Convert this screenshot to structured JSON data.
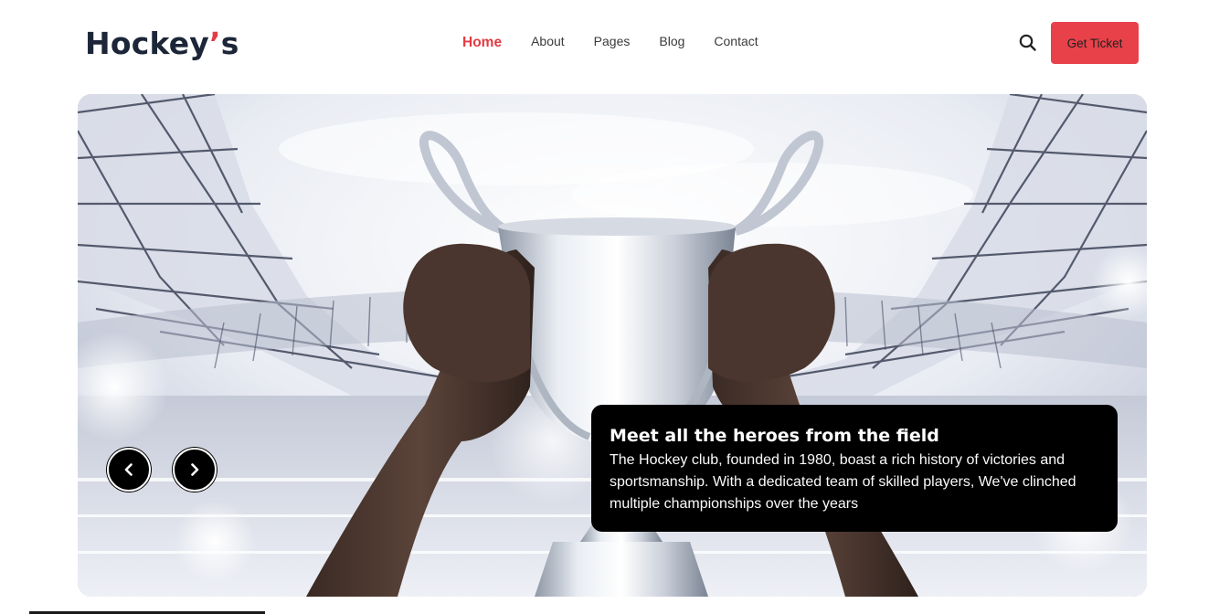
{
  "header": {
    "logo_main": "Hockey",
    "logo_apostrophe": "’",
    "logo_suffix": "s",
    "nav": [
      {
        "label": "Home",
        "active": true
      },
      {
        "label": "About",
        "active": false
      },
      {
        "label": "Pages",
        "active": false
      },
      {
        "label": "Blog",
        "active": false
      },
      {
        "label": "Contact",
        "active": false
      }
    ],
    "search_icon": "search-icon",
    "cta_label": "Get Ticket"
  },
  "hero": {
    "prev_icon": "chevron-left-icon",
    "next_icon": "chevron-right-icon",
    "caption_title": "Meet all the heroes from the field",
    "caption_text": "The Hockey club, founded in 1980, boast a rich history of victories and sportsmanship. With a dedicated team of skilled players, We've clinched multiple championships over the years"
  },
  "colors": {
    "brand_red": "#e23b43",
    "button_red": "#e8414a",
    "logo_dark": "#1c2638",
    "caption_bg": "#000000"
  }
}
